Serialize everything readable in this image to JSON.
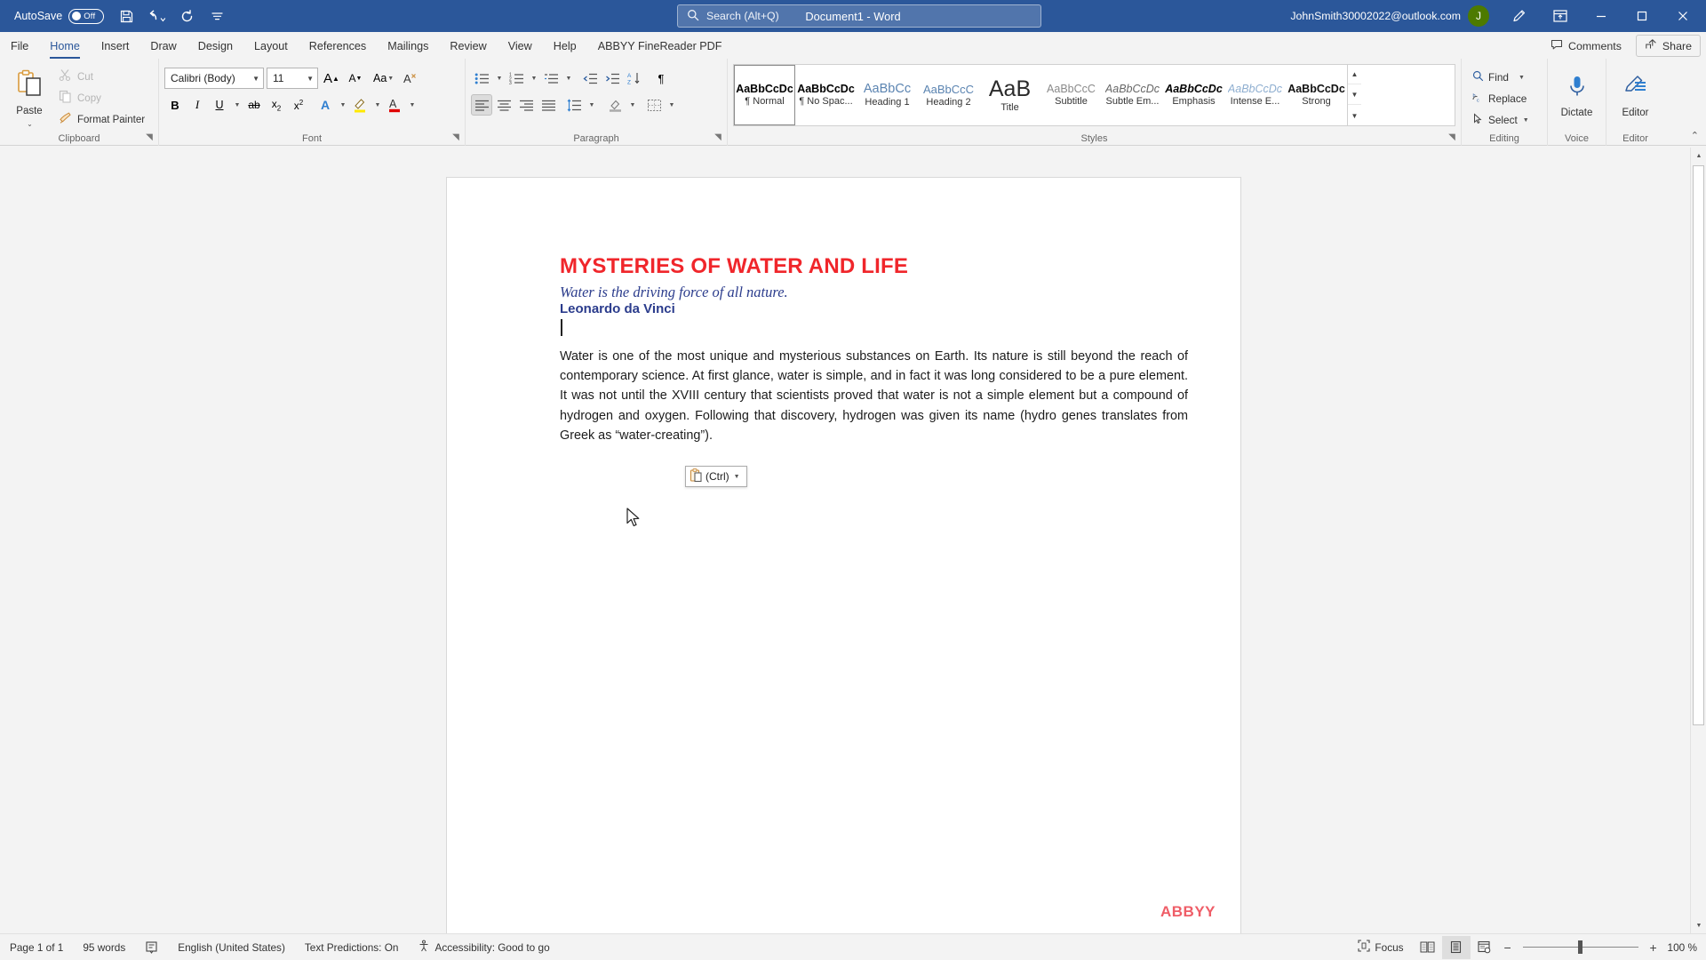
{
  "titlebar": {
    "autosave_label": "AutoSave",
    "autosave_state": "Off",
    "save_icon": "save-icon",
    "undo_icon": "undo-icon",
    "redo_icon": "redo-icon",
    "customize_icon": "customize-quick-access-icon",
    "document_title": "Document1  -  Word",
    "search_placeholder": "Search (Alt+Q)",
    "search_icon": "search-icon",
    "account_name": "JohnSmith30002022@outlook.com",
    "avatar_initial": "J",
    "pen_icon": "ink-pen-icon",
    "ribbon_display_icon": "ribbon-display-options-icon",
    "minimize_icon": "minimize-icon",
    "maximize_icon": "maximize-icon",
    "close_icon": "close-icon",
    "accent_color": "#2b579a",
    "avatar_color": "#4d7a00"
  },
  "tabs": [
    {
      "label": "File",
      "active": false
    },
    {
      "label": "Home",
      "active": true
    },
    {
      "label": "Insert",
      "active": false
    },
    {
      "label": "Draw",
      "active": false
    },
    {
      "label": "Design",
      "active": false
    },
    {
      "label": "Layout",
      "active": false
    },
    {
      "label": "References",
      "active": false
    },
    {
      "label": "Mailings",
      "active": false
    },
    {
      "label": "Review",
      "active": false
    },
    {
      "label": "View",
      "active": false
    },
    {
      "label": "Help",
      "active": false
    },
    {
      "label": "ABBYY FineReader PDF",
      "active": false
    }
  ],
  "tabstrip_right": {
    "comments_label": "Comments",
    "comments_icon": "comment-bubble-icon",
    "share_label": "Share",
    "share_icon": "share-icon"
  },
  "ribbon": {
    "clipboard": {
      "group_label": "Clipboard",
      "paste_label": "Paste",
      "paste_icon": "paste-clipboard-icon",
      "cut_label": "Cut",
      "cut_icon": "scissors-icon",
      "copy_label": "Copy",
      "copy_icon": "copy-icon",
      "format_painter_label": "Format Painter",
      "format_painter_icon": "format-painter-brush-icon",
      "dialog_launcher_icon": "dialog-launcher-icon"
    },
    "font": {
      "group_label": "Font",
      "font_family_value": "Calibri (Body)",
      "font_size_value": "11",
      "grow_font_icon": "grow-font-icon",
      "shrink_font_icon": "shrink-font-icon",
      "change_case_icon": "change-case-icon",
      "clear_formatting_icon": "clear-formatting-icon",
      "bold_icon": "bold-icon",
      "italic_icon": "italic-icon",
      "underline_icon": "underline-icon",
      "strikethrough_icon": "strikethrough-icon",
      "subscript_icon": "subscript-icon",
      "superscript_icon": "superscript-icon",
      "text_effects_icon": "text-effects-icon",
      "highlight_icon": "text-highlight-color-icon",
      "font_color_icon": "font-color-icon",
      "highlight_color": "#ffe900",
      "font_color": "#e00000",
      "dialog_launcher_icon": "dialog-launcher-icon"
    },
    "paragraph": {
      "group_label": "Paragraph",
      "bullets_icon": "bullets-icon",
      "numbering_icon": "numbering-icon",
      "multilevel_icon": "multilevel-list-icon",
      "decrease_indent_icon": "decrease-indent-icon",
      "increase_indent_icon": "increase-indent-icon",
      "sort_icon": "sort-az-icon",
      "show_marks_icon": "show-formatting-marks-icon",
      "align_left_icon": "align-left-icon",
      "align_center_icon": "align-center-icon",
      "align_right_icon": "align-right-icon",
      "justify_icon": "justify-icon",
      "line_spacing_icon": "line-spacing-icon",
      "shading_icon": "shading-icon",
      "borders_icon": "borders-icon",
      "dialog_launcher_icon": "dialog-launcher-icon"
    },
    "styles": {
      "group_label": "Styles",
      "dialog_launcher_icon": "dialog-launcher-icon",
      "scroll_up_icon": "gallery-scroll-up-icon",
      "scroll_down_icon": "gallery-scroll-down-icon",
      "more_icon": "gallery-more-icon",
      "items": [
        {
          "preview": "AaBbCcDc",
          "name": "¶ Normal",
          "selected": true,
          "style": "normal"
        },
        {
          "preview": "AaBbCcDc",
          "name": "¶ No Spac...",
          "selected": false,
          "style": "nospacing"
        },
        {
          "preview": "AaBbCc",
          "name": "Heading 1",
          "selected": false,
          "style": "heading1"
        },
        {
          "preview": "AaBbCcC",
          "name": "Heading 2",
          "selected": false,
          "style": "heading2"
        },
        {
          "preview": "AaB",
          "name": "Title",
          "selected": false,
          "style": "title"
        },
        {
          "preview": "AaBbCcC",
          "name": "Subtitle",
          "selected": false,
          "style": "subtitle"
        },
        {
          "preview": "AaBbCcDc",
          "name": "Subtle Em...",
          "selected": false,
          "style": "subtleem"
        },
        {
          "preview": "AaBbCcDc",
          "name": "Emphasis",
          "selected": false,
          "style": "emphasis"
        },
        {
          "preview": "AaBbCcDc",
          "name": "Intense E...",
          "selected": false,
          "style": "intenseem"
        },
        {
          "preview": "AaBbCcDc",
          "name": "Strong",
          "selected": false,
          "style": "strong"
        }
      ]
    },
    "editing": {
      "group_label": "Editing",
      "find_label": "Find",
      "find_icon": "find-magnifier-icon",
      "replace_label": "Replace",
      "replace_icon": "replace-icon",
      "select_label": "Select",
      "select_icon": "select-pointer-icon"
    },
    "voice": {
      "group_label": "Voice",
      "dictate_label": "Dictate",
      "dictate_icon": "microphone-icon"
    },
    "editor": {
      "group_label": "Editor",
      "editor_label": "Editor",
      "editor_icon": "editor-pen-icon"
    },
    "collapse_icon": "collapse-ribbon-icon"
  },
  "document": {
    "title": "MYSTERIES OF WATER AND LIFE",
    "title_color": "#f0262b",
    "subtitle": "Water is the driving force of all nature.",
    "author": "Leonardo da Vinci",
    "heading_color": "#2b3c8c",
    "body": "Water is one of the most unique and mysterious substances on Earth. Its nature is still beyond the reach of contemporary science. At first glance, water is simple, and in fact it was long considered to be a pure element. It was not until the XVIII century that scientists proved that water is not a simple element but a compound of hydrogen and oxygen. Following that discovery, hydrogen was given its name (hydro genes translates from Greek as “water-creating”).",
    "paste_options_label": "(Ctrl)",
    "paste_options_icon": "paste-options-clipboard-icon",
    "watermark": "ABBYY",
    "watermark_color": "#ef5d67"
  },
  "scrollbar": {
    "up_arrow_icon": "scroll-up-arrow-icon",
    "down_arrow_icon": "scroll-down-arrow-icon"
  },
  "statusbar": {
    "page_label": "Page 1 of 1",
    "word_count": "95 words",
    "proofing_icon": "proofing-errors-icon",
    "language": "English (United States)",
    "text_predictions": "Text Predictions: On",
    "accessibility_icon": "accessibility-icon",
    "accessibility": "Accessibility: Good to go",
    "focus_label": "Focus",
    "focus_icon": "focus-mode-icon",
    "read_mode_icon": "read-mode-icon",
    "print_layout_icon": "print-layout-icon",
    "web_layout_icon": "web-layout-icon",
    "zoom_out_icon": "zoom-out-icon",
    "zoom_in_icon": "zoom-in-icon",
    "zoom_value": "100 %"
  }
}
